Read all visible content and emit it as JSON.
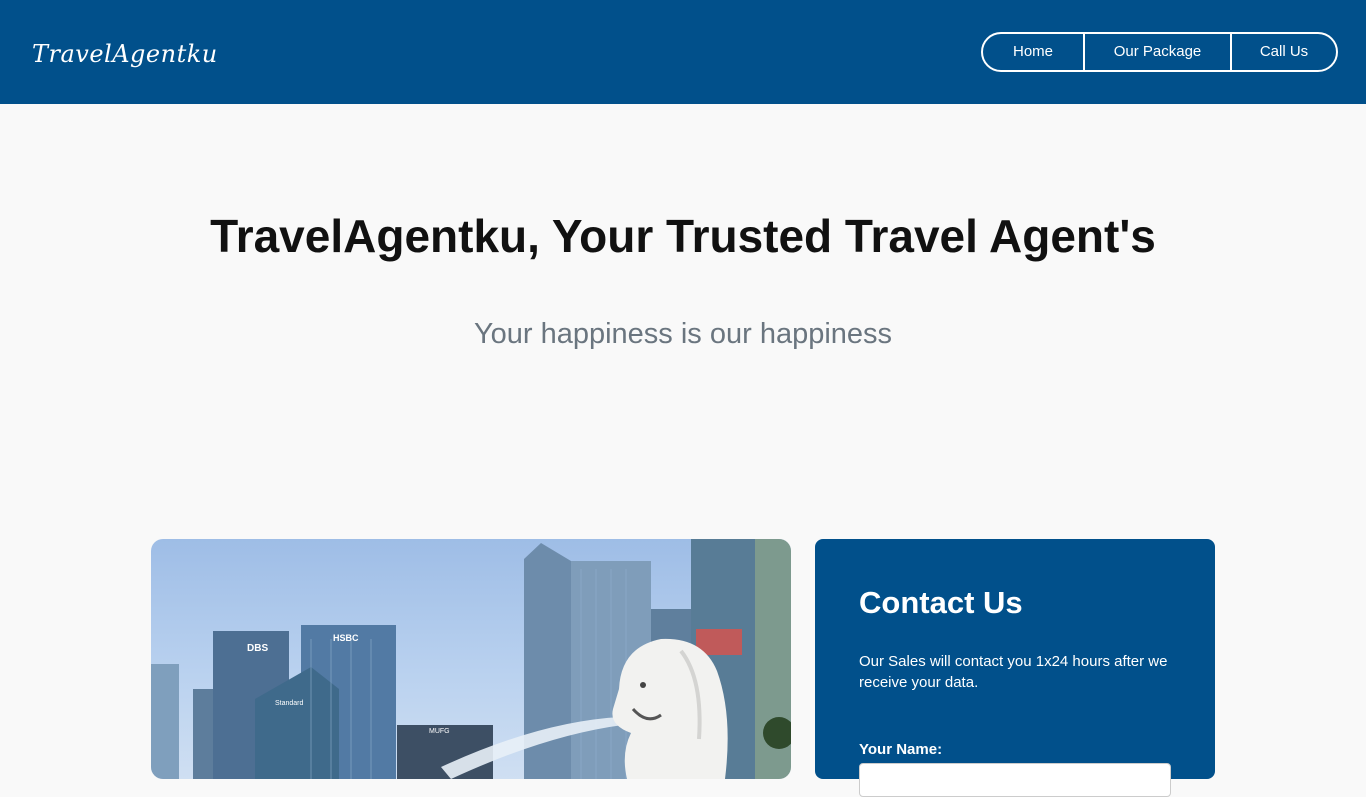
{
  "navbar": {
    "logo": "TravelAgentku",
    "links": [
      "Home",
      "Our Package",
      "Call Us"
    ]
  },
  "hero": {
    "title": "TravelAgentku, Your Trusted Travel Agent's",
    "subtitle": "Your happiness is our happiness"
  },
  "photo": {
    "signs": [
      "DBS",
      "HSBC",
      "Standard",
      "MUFG"
    ]
  },
  "contact": {
    "title": "Contact Us",
    "description": "Our Sales will contact you 1x24 hours after we receive your data.",
    "name_label": "Your Name:",
    "name_value": ""
  },
  "colors": {
    "brand": "#01508b",
    "background": "#f9f9f9",
    "subtitle": "#6a757f"
  }
}
